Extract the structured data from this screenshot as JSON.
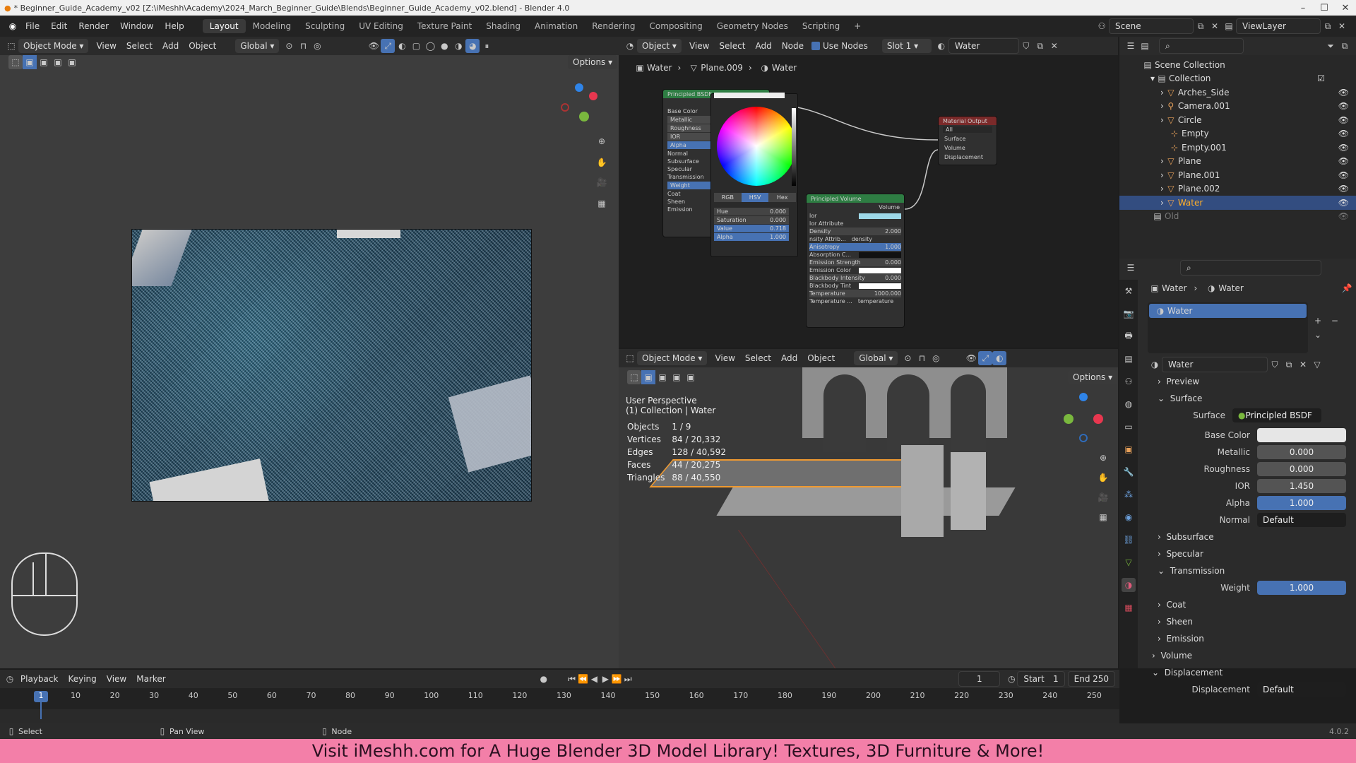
{
  "window": {
    "title": "* Beginner_Guide_Academy_v02 [Z:\\iMeshh\\Academy\\2024_March_Beginner_Guide\\Blends\\Beginner_Guide_Academy_v02.blend] - Blender 4.0"
  },
  "menu": [
    "File",
    "Edit",
    "Render",
    "Window",
    "Help"
  ],
  "workspaces": [
    "Layout",
    "Modeling",
    "Sculpting",
    "UV Editing",
    "Texture Paint",
    "Shading",
    "Animation",
    "Rendering",
    "Compositing",
    "Geometry Nodes",
    "Scripting"
  ],
  "scene": {
    "name": "Scene",
    "view_layer": "ViewLayer"
  },
  "left_header": {
    "mode": "Object Mode",
    "menus": [
      "View",
      "Select",
      "Add",
      "Object"
    ],
    "orientation": "Global",
    "options": "Options"
  },
  "node_header": {
    "type": "Object",
    "menus": [
      "View",
      "Select",
      "Add",
      "Node"
    ],
    "use_nodes": "Use Nodes",
    "slot": "Slot 1",
    "material": "Water"
  },
  "node_breadcrumb": [
    "Water",
    "Plane.009",
    "Water"
  ],
  "nodes": {
    "bsdf": {
      "title": "Principled BSDF",
      "out": "BSDF",
      "inputs": [
        "Base Color",
        "Metallic",
        "Roughness",
        "IOR",
        "Alpha",
        "Normal",
        "Subsurface",
        "Specular",
        "Transmission",
        "Weight",
        "Coat",
        "Sheen",
        "Emission"
      ]
    },
    "output": {
      "title": "Material Output",
      "target": "All",
      "inputs": [
        "Surface",
        "Volume",
        "Displacement"
      ]
    },
    "volume": {
      "title": "Principled Volume",
      "out": "Volume",
      "rows": [
        [
          "lor",
          ""
        ],
        [
          "lor Attribute",
          ""
        ],
        [
          "Density",
          "2.000"
        ],
        [
          "nsity Attrib...",
          "density"
        ],
        [
          "Anisotropy",
          "1.000"
        ],
        [
          "Absorption C...",
          ""
        ],
        [
          "Emission Strength",
          "0.000"
        ],
        [
          "Emission Color",
          ""
        ],
        [
          "Blackbody Intensity",
          "0.000"
        ],
        [
          "Blackbody Tint",
          ""
        ],
        [
          "Temperature",
          "1000.000"
        ],
        [
          "Temperature ...",
          "temperature"
        ]
      ]
    },
    "picker": {
      "modes": [
        "RGB",
        "HSV",
        "Hex"
      ],
      "rows": [
        [
          "Hue",
          "0.000"
        ],
        [
          "Saturation",
          "0.000"
        ],
        [
          "Value",
          "0.718"
        ],
        [
          "Alpha",
          "1.000"
        ]
      ]
    }
  },
  "view3d": {
    "mode": "Object Mode",
    "menus": [
      "View",
      "Select",
      "Add",
      "Object"
    ],
    "orientation": "Global",
    "options": "Options",
    "perspective": "User Perspective",
    "collection": "(1) Collection | Water",
    "stats": [
      [
        "Objects",
        "1 / 9"
      ],
      [
        "Vertices",
        "84 / 20,332"
      ],
      [
        "Edges",
        "128 / 40,592"
      ],
      [
        "Faces",
        "44 / 20,275"
      ],
      [
        "Triangles",
        "88 / 40,550"
      ]
    ]
  },
  "outliner": {
    "root": "Scene Collection",
    "collection": "Collection",
    "items": [
      "Arches_Side",
      "Camera.001",
      "Circle",
      "Empty",
      "Empty.001",
      "Plane",
      "Plane.001",
      "Plane.002",
      "Water",
      "Old"
    ]
  },
  "properties": {
    "breadcrumb": [
      "Water",
      "Water"
    ],
    "slot": "Water",
    "material": "Water",
    "sections": {
      "preview": "Preview",
      "surface": "Surface",
      "volume": "Volume",
      "displacement": "Displacement"
    },
    "surface_shader": "Principled BSDF",
    "rows": [
      [
        "Base Color",
        ""
      ],
      [
        "Metallic",
        "0.000"
      ],
      [
        "Roughness",
        "0.000"
      ],
      [
        "IOR",
        "1.450"
      ],
      [
        "Alpha",
        "1.000"
      ],
      [
        "Normal",
        "Default"
      ]
    ],
    "subsections": [
      "Subsurface",
      "Specular",
      "Transmission"
    ],
    "transmission_weight": [
      "Weight",
      "1.000"
    ],
    "more": [
      "Coat",
      "Sheen",
      "Emission"
    ],
    "displacement_row": [
      "Displacement",
      "Default"
    ]
  },
  "timeline": {
    "menus": [
      "Playback",
      "Keying",
      "View",
      "Marker"
    ],
    "current": "1",
    "start_label": "Start",
    "start": "1",
    "end_label": "End",
    "end": "250",
    "ticks": [
      "1",
      "10",
      "20",
      "30",
      "40",
      "50",
      "60",
      "70",
      "80",
      "90",
      "100",
      "110",
      "120",
      "130",
      "140",
      "150",
      "160",
      "170",
      "180",
      "190",
      "200",
      "210",
      "220",
      "230",
      "240",
      "250"
    ]
  },
  "status": {
    "select": "Select",
    "pan": "Pan View",
    "node": "Node",
    "version": "4.0.2"
  },
  "banner": "Visit iMeshh.com for A Huge Blender 3D Model Library! Textures, 3D Furniture & More!"
}
